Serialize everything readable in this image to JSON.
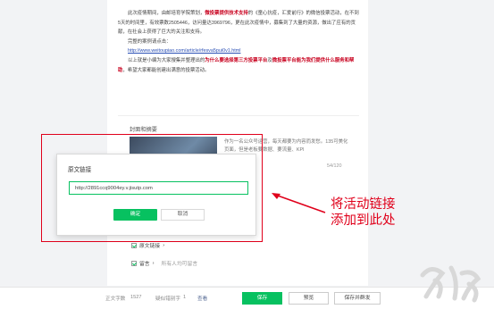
{
  "article": {
    "para1_pre": "此次疫情期间，由邮培育学院策划，",
    "para1_red": "微投票提供技术支持",
    "para1_post": "的《童心抗疫，汇爱前行》的微信投票活动，在不到5天的时间里，有效票数2505446，访问量达3969796，更在此次疫情中，募集到了大量的资源，做出了应有的贡献，在社会上获得了巨大的关注和支持。",
    "para2": "完整的案例请点击：",
    "case_link": "http://www.weitoupiao.com/article/rfesva5pui0v1.html",
    "para3_pre": "以上就是小编为大家搜集并整理出的",
    "para3_red": "为什么要选择第三方投票平台",
    "para3_mid": "及",
    "para3_red2": "微投票平台能为我们提供什么服务和帮助",
    "para3_post": "，希望大家都能创建出满意的投票活动。"
  },
  "cover": {
    "title": "封面和摘要",
    "desc": "作为一名公众号运营，每天都要为内容而发愁。135可美化页面，但是老板要数据、要流量、KPI",
    "count": "54/120"
  },
  "dialog": {
    "title": "原文链接",
    "input_value": "http://2891ccq9004ey.v.jisutp.com",
    "confirm_label": "确定",
    "cancel_label": "取消"
  },
  "annotation": {
    "line1": "将活动链接",
    "line2": "添加到此处",
    "color": "#e0001b"
  },
  "options": {
    "original_link": "原文链接",
    "original_link_arrow": "›",
    "comment": "留言",
    "comment_arrow": "›",
    "comment_hint": "所有人均可留言"
  },
  "bottom_bar": {
    "word_count_label": "正文字数",
    "word_count": "1527",
    "similar_label": "疑似错别字",
    "similar_count": "1",
    "similar_link": "查看",
    "save": "保存",
    "preview": "预览",
    "save_publish": "保存并群发"
  },
  "colors": {
    "accent": "#07c160",
    "highlight_red": "#c8001e",
    "link_blue": "#2a4fb5"
  }
}
